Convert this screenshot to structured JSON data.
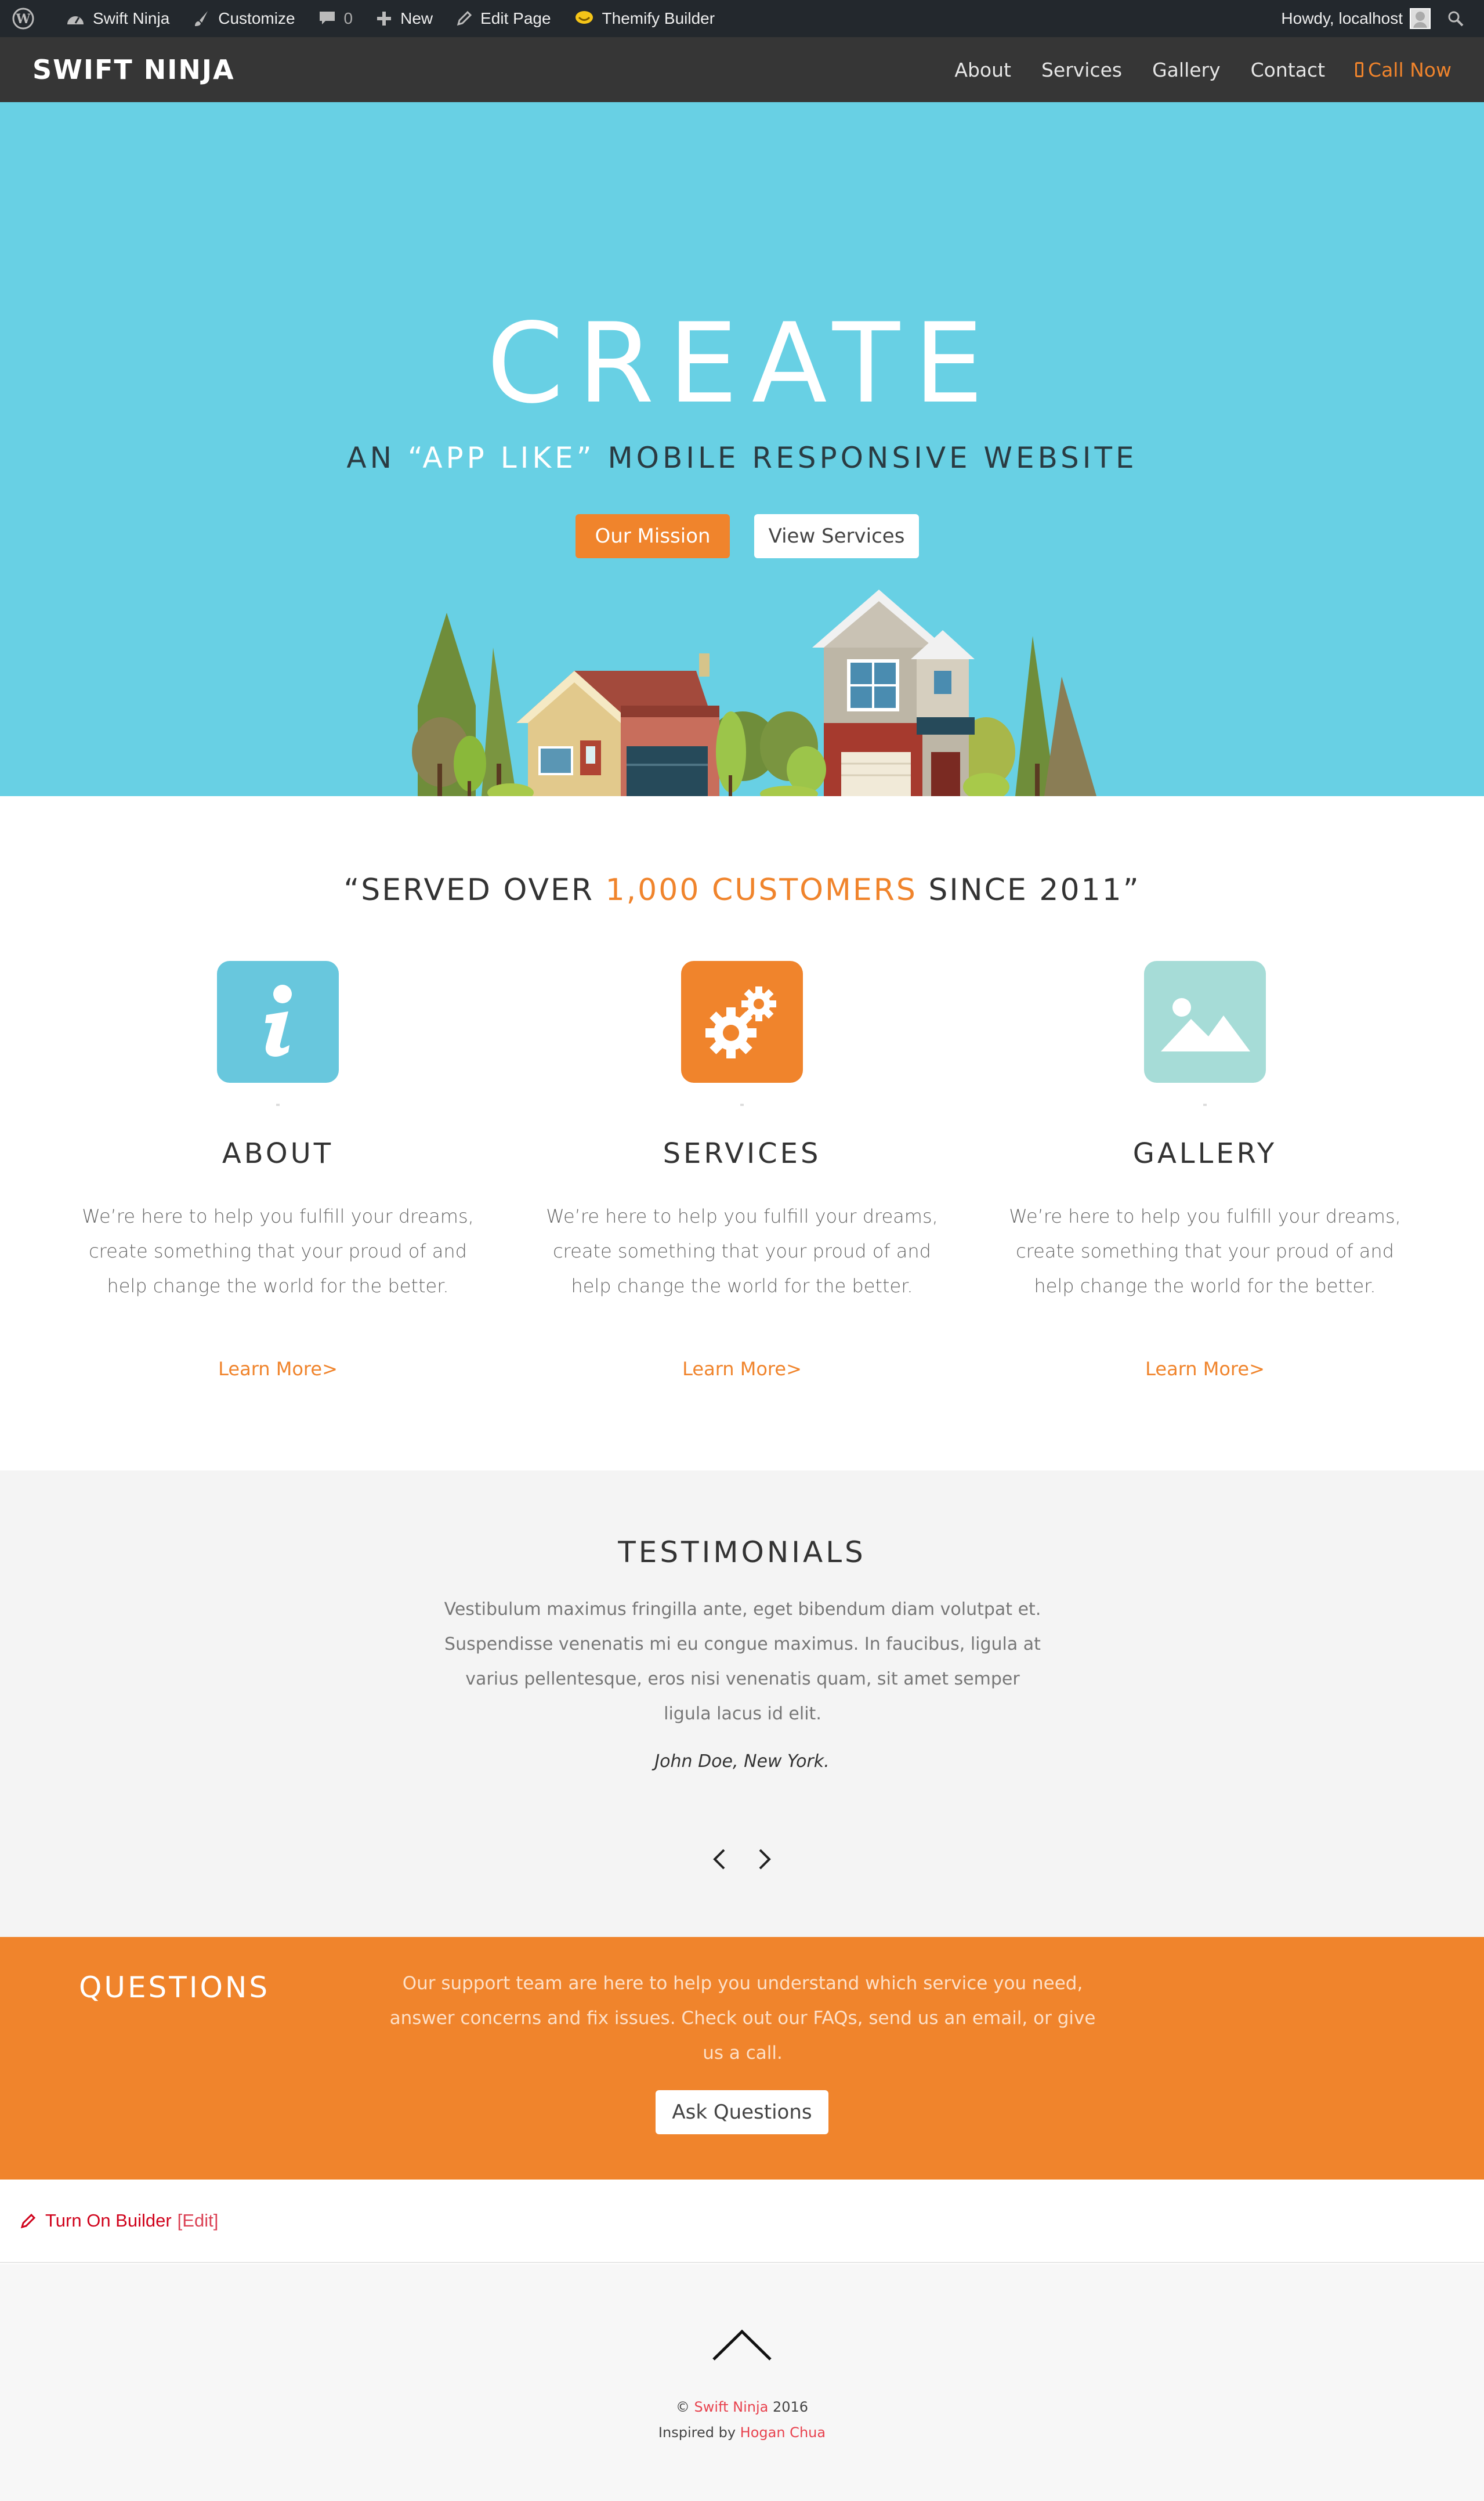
{
  "admin_bar": {
    "site_name": "Swift Ninja",
    "customize": "Customize",
    "comments_count": "0",
    "new": "New",
    "edit_page": "Edit Page",
    "themify_builder": "Themify Builder",
    "howdy": "Howdy, localhost",
    "icons": [
      "wordpress-icon",
      "dashboard-icon",
      "brush-icon",
      "comment-icon",
      "plus-icon",
      "pencil-icon",
      "themify-icon",
      "avatar",
      "search-icon"
    ]
  },
  "header": {
    "logo": "SWIFT NINJA",
    "nav": [
      "About",
      "Services",
      "Gallery",
      "Contact"
    ],
    "call_now": "Call Now"
  },
  "hero": {
    "title": "CREATE",
    "subtitle_before": "AN ",
    "subtitle_highlight": "“APP LIKE”",
    "subtitle_after": " MOBILE RESPONSIVE WEBSITE",
    "btn_mission": "Our Mission",
    "btn_services": "View Services",
    "background_color": "#68d0e4"
  },
  "served": {
    "before": "“SERVED OVER ",
    "accent": "1,000 CUSTOMERS",
    "after": " SINCE 2011”"
  },
  "features": [
    {
      "title": "ABOUT",
      "text": "We’re here to help you fulfill your dreams, create something that your proud of and help change the world for the better.",
      "link": "Learn More>",
      "icon": "info-icon",
      "color": "#68c7dd"
    },
    {
      "title": "SERVICES",
      "text": "We’re here to help you fulfill your dreams, create something that your proud of and help change the world for the better.",
      "link": "Learn More>",
      "icon": "gears-icon",
      "color": "#f0842c"
    },
    {
      "title": "GALLERY",
      "text": "We’re here to help you fulfill your dreams, create something that your proud of and help change the world for the better.",
      "link": "Learn More>",
      "icon": "image-icon",
      "color": "#a6dcd7"
    }
  ],
  "testimonials": {
    "title": "TESTIMONIALS",
    "quote": "Vestibulum maximus fringilla ante, eget bibendum diam volutpat et. Suspendisse venenatis mi eu congue maximus. In faucibus, ligula at varius pellentesque, eros nisi venenatis quam, sit amet semper ligula lacus id elit.",
    "author": "John Doe, New York."
  },
  "questions": {
    "title": "QUESTIONS",
    "text": "Our support team are here to help you understand which service you need, answer concerns and fix issues. Check out our FAQs, send us an email, or give us a call.",
    "button": "Ask Questions",
    "background_color": "#f0842c"
  },
  "builder_bar": {
    "turn_on": "Turn On Builder",
    "edit": "[Edit]"
  },
  "footer": {
    "copyright_symbol": "©",
    "site_link": "Swift Ninja",
    "year": "2016",
    "inspired_by": "Inspired by",
    "author_link": "Hogan Chua"
  }
}
